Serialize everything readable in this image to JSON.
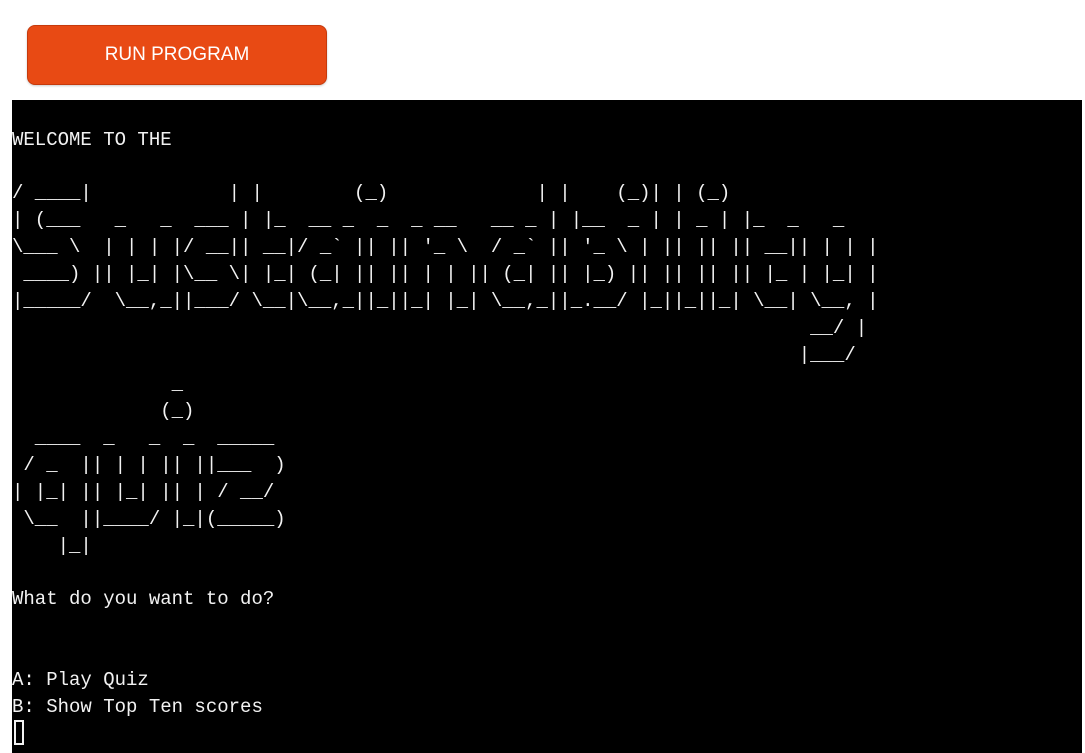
{
  "toolbar": {
    "run_label": "RUN PROGRAM",
    "run_color": "#e84a14"
  },
  "terminal": {
    "background": "#000000",
    "foreground": "#f2f2f2",
    "welcome": "WELCOME TO THE",
    "title_art": "/ ____|            | |        (_)             | |    (_)| | (_)\n| (___   _   _  ___ | |_  __ _  _  _ __   __ _ | |__  _ | | _ | |_  _   _\n\\___ \\  | | | |/ __|| __|/ _` || || '_ \\  / _` || '_ \\ | || || || __|| | | |\n ____) || |_| |\\__ \\| |_| (_| || || | | || (_| || |_) || || || || |_ | |_| |\n|_____/  \\__,_||___/ \\__|\\__,_||_||_| |_| \\__,_||_.__/ |_||_||_| \\__| \\__, |\n                                                                      __/ |\n                                                                     |___/",
    "quiz_art": "              _\n             (_)\n  ____  _   _  _  _____\n / _  || | | || ||___  )\n| |_| || |_| || | / __/\n \\__  ||____/ |_|(_____)\n    |_|",
    "prompt": "What do you want to do?",
    "option_a": "A: Play Quiz",
    "option_b": "B: Show Top Ten scores"
  }
}
